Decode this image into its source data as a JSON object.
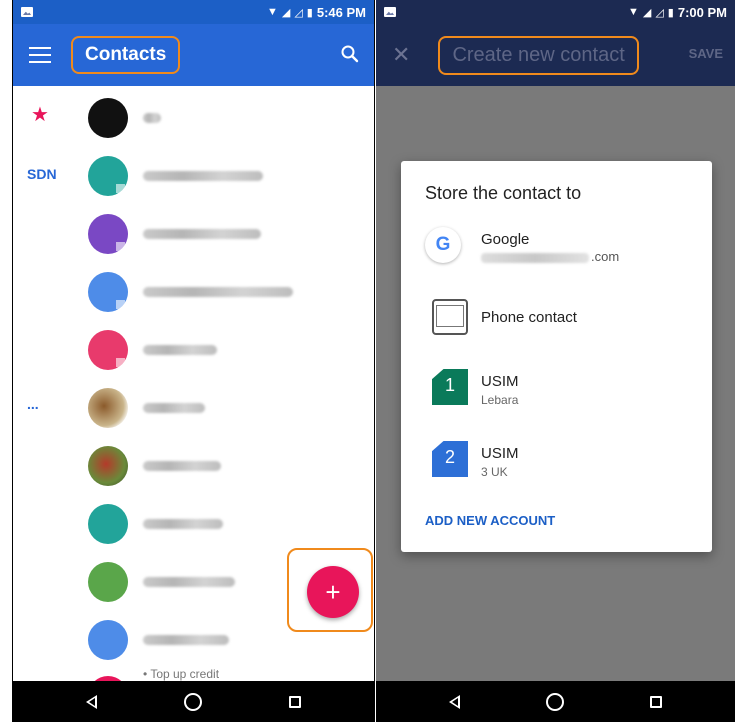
{
  "left": {
    "status_time": "5:46 PM",
    "toolbar_title": "Contacts",
    "section_marks": {
      "favorites": "★",
      "sdn": "SDN",
      "more": "..."
    },
    "fab_label": "+",
    "peek_text": "• Top up credit"
  },
  "right": {
    "status_time": "7:00 PM",
    "close_label": "✕",
    "toolbar_title": "Create new contact",
    "save_label": "SAVE",
    "dialog": {
      "title": "Store the contact to",
      "options": [
        {
          "label": "Google",
          "sublabel": ".com",
          "icon": "google-icon"
        },
        {
          "label": "Phone contact",
          "sublabel": "",
          "icon": "phone-icon"
        },
        {
          "label": "USIM",
          "sublabel": "Lebara",
          "icon": "sim-card-icon",
          "number": "1"
        },
        {
          "label": "USIM",
          "sublabel": "3 UK",
          "icon": "sim-card-icon",
          "number": "2"
        }
      ],
      "add_account": "ADD NEW ACCOUNT"
    }
  },
  "colors": {
    "primary": "#2767d6",
    "status_bar": "#1c5fc6",
    "accent": "#e8155a",
    "highlight": "#f08a1c",
    "dim_toolbar": "#1c2a52"
  }
}
